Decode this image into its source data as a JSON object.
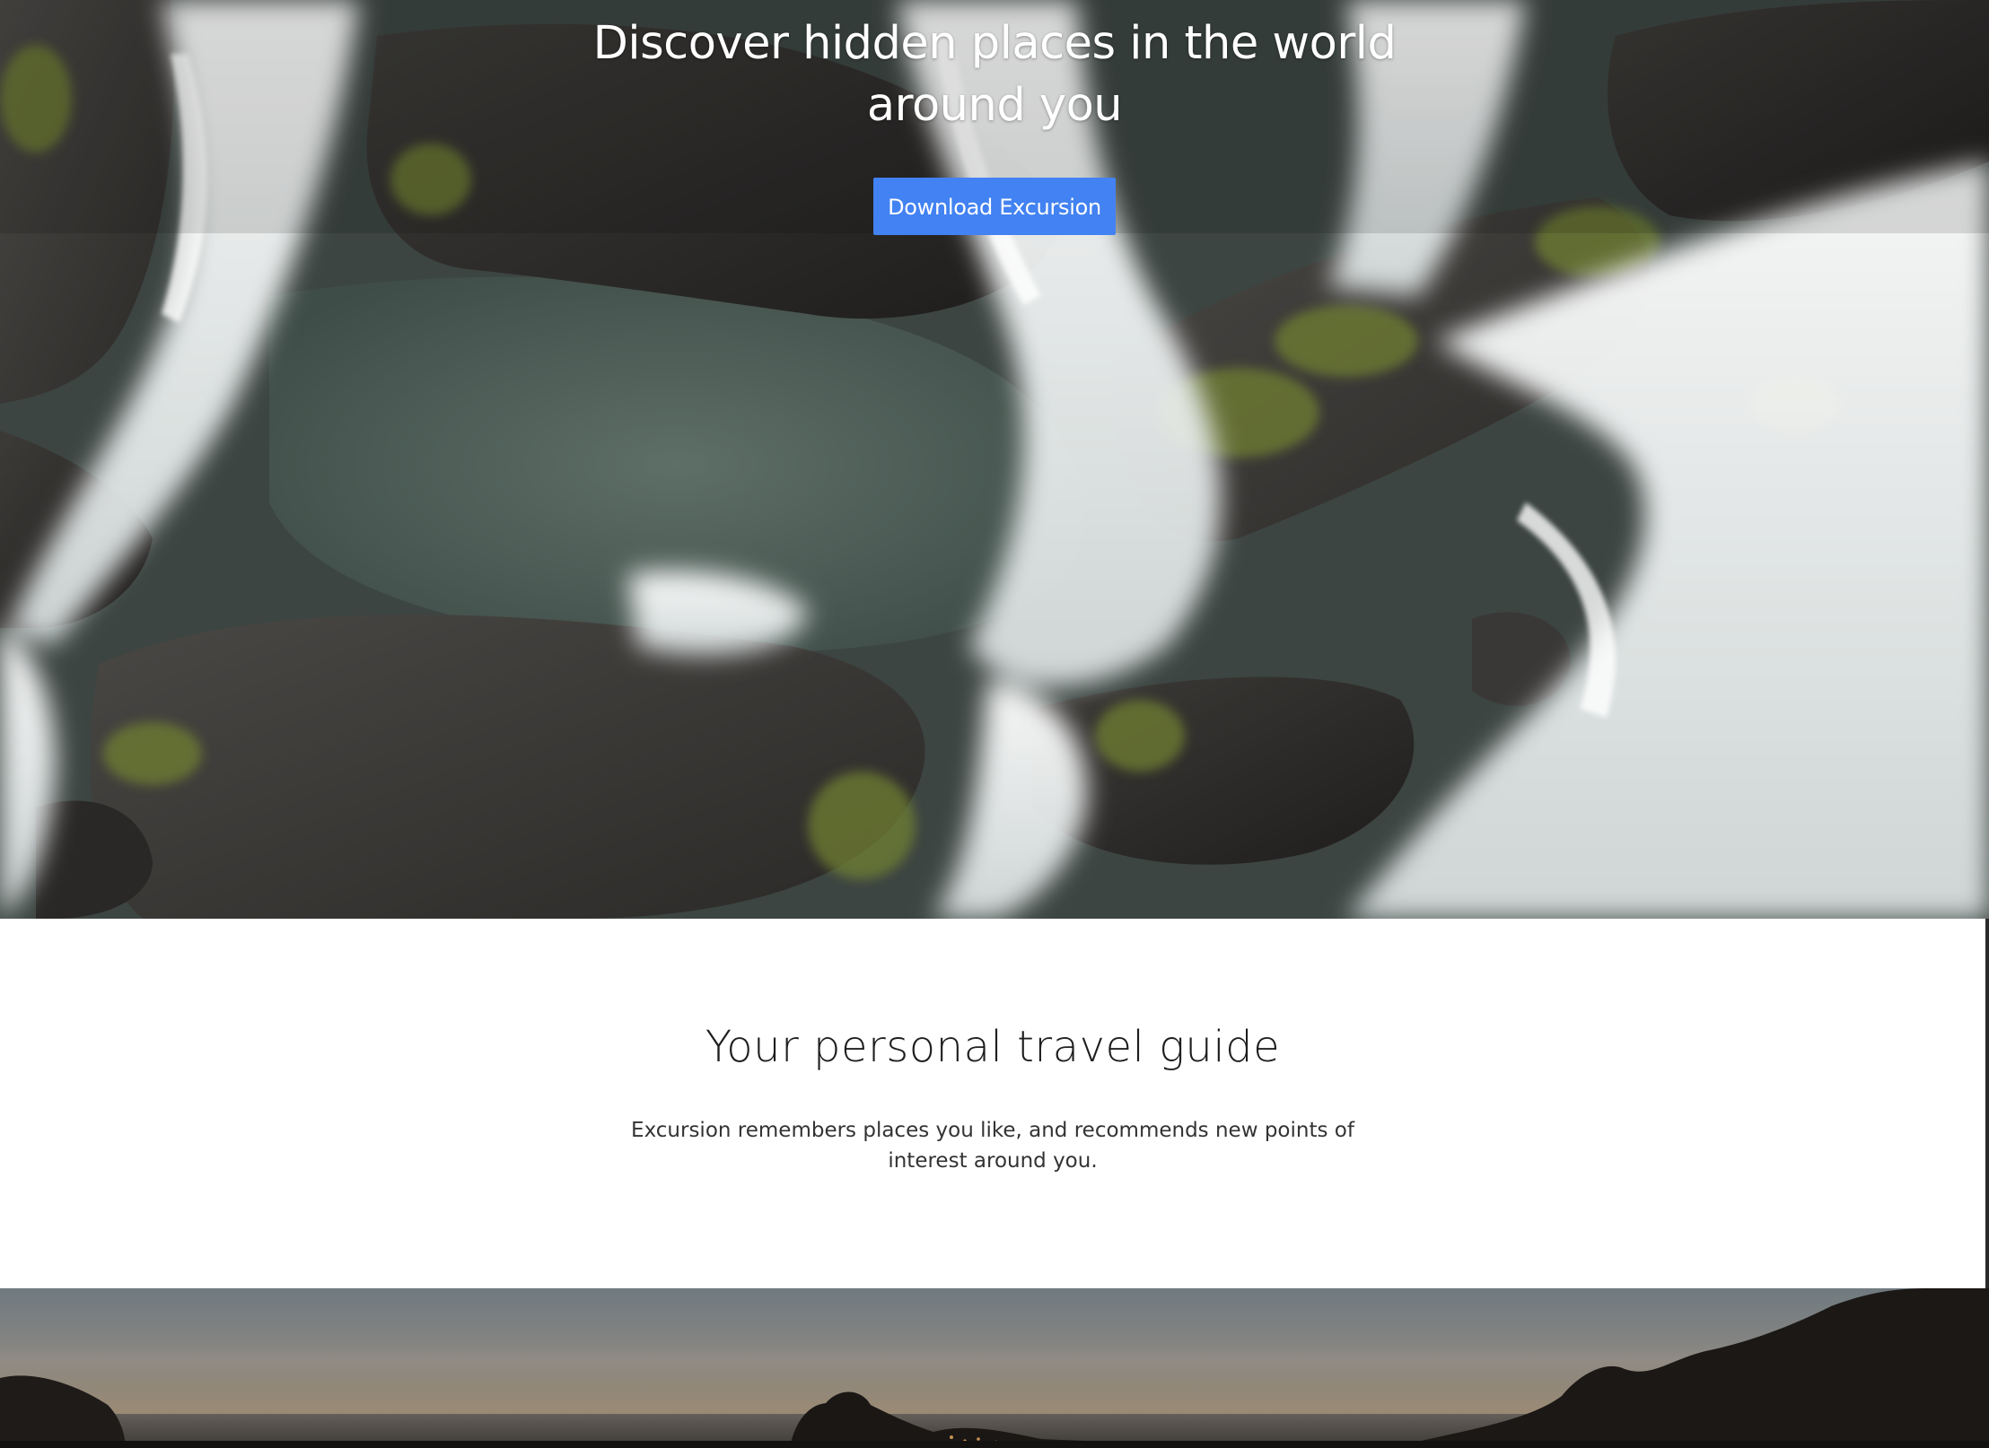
{
  "hero": {
    "title": "Discover hidden places in the world around you",
    "download_label": "Download Excursion"
  },
  "intro": {
    "title": "Your personal travel guide",
    "text": "Excursion remembers places you like, and recommends new points of interest around you."
  },
  "colors": {
    "accent": "#4282f2",
    "heading": "#1e1e1e",
    "body_text": "#333333"
  }
}
